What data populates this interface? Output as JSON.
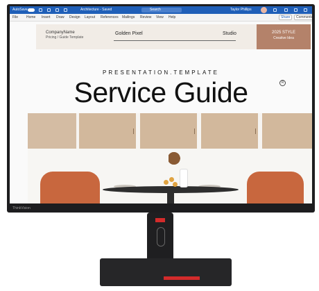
{
  "titlebar": {
    "autosave_label": "AutoSave",
    "document_title": "Architecture - Saved",
    "search_label": "Search",
    "user_name": "Taylor Phillips"
  },
  "menu": [
    "File",
    "Home",
    "Insert",
    "Draw",
    "Design",
    "Layout",
    "References",
    "Mailings",
    "Review",
    "View",
    "Help"
  ],
  "actions": {
    "share": "Share",
    "comments": "Comments"
  },
  "document": {
    "company_name": "CompanyName",
    "subtitle": "Pricing / Guide Template",
    "golden_pixel": "Golden Pixel",
    "studio": "Studio",
    "badge_line1": "2025 STYLE",
    "badge_line2": "Creative Idea",
    "eyebrow": "PRESENTATION.TEMPLATE",
    "registered": "R",
    "title": "Service Guide"
  },
  "monitor_brand": "ThinkVision",
  "colors": {
    "titlebar": "#1f5fb8",
    "badge": "#b4826a",
    "accent_red": "#d32b2b"
  }
}
